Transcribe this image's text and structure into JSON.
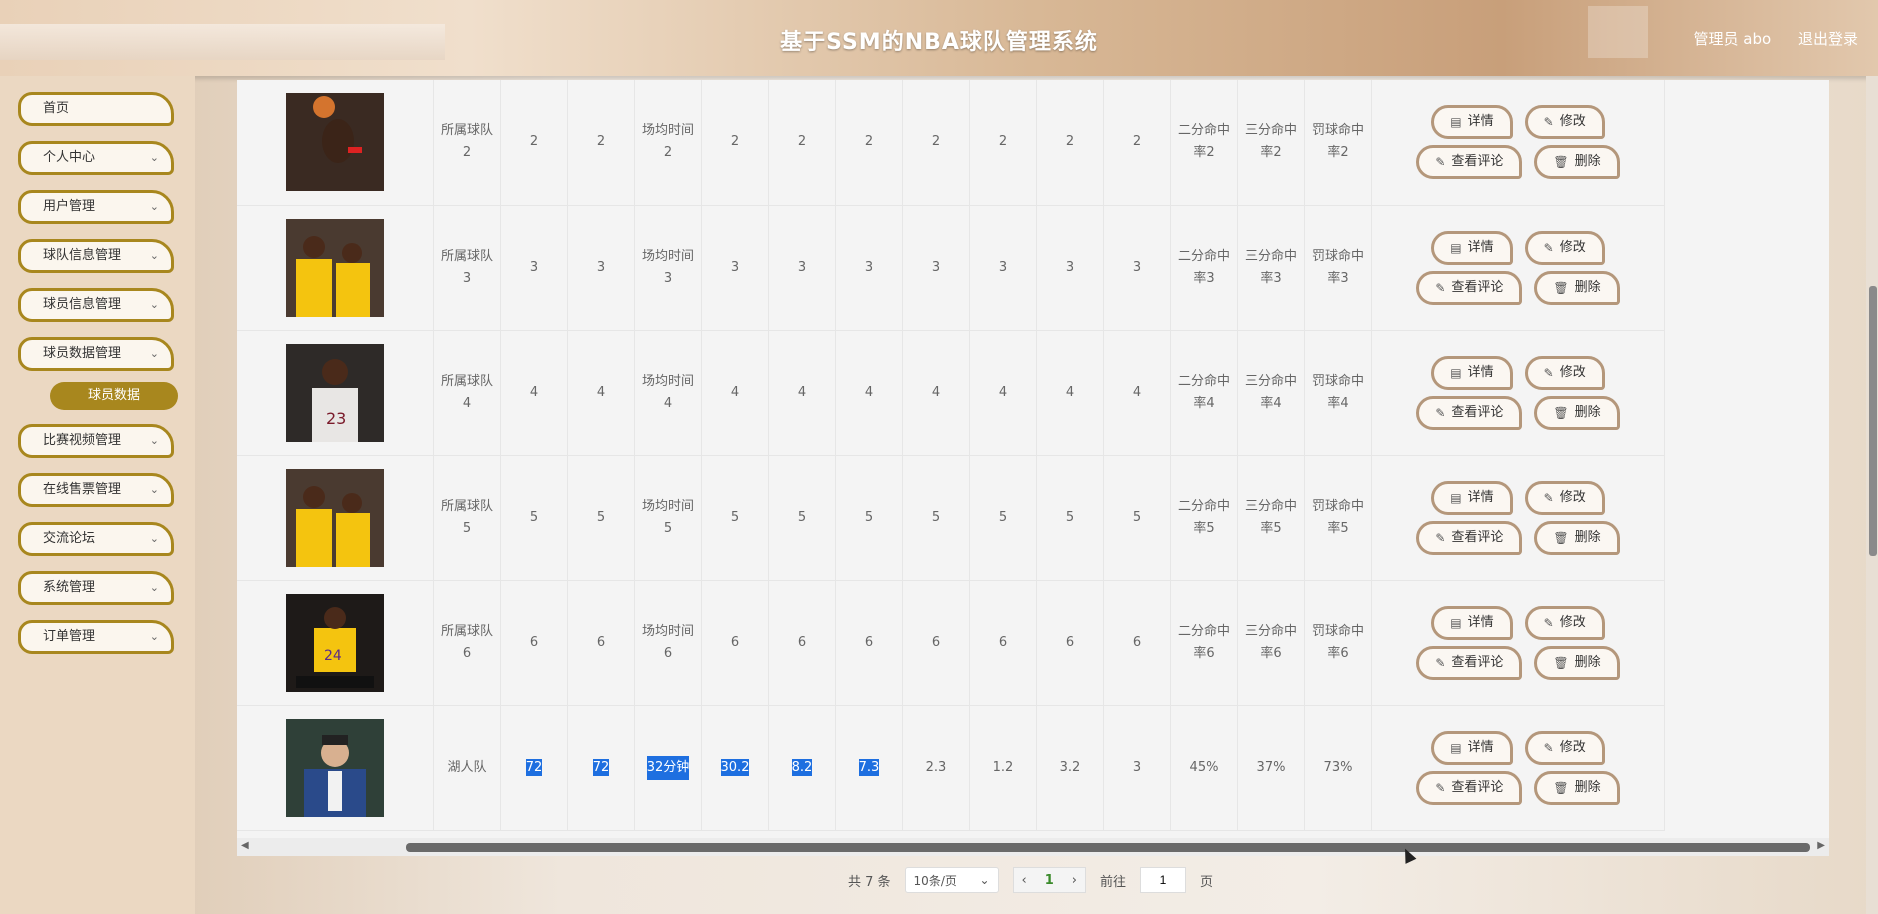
{
  "header": {
    "title": "基于SSM的NBA球队管理系统",
    "user_label": "管理员 abo",
    "logout_label": "退出登录"
  },
  "sidebar": {
    "items": [
      {
        "label": "首页",
        "has_chevron": false
      },
      {
        "label": "个人中心",
        "has_chevron": true
      },
      {
        "label": "用户管理",
        "has_chevron": true
      },
      {
        "label": "球队信息管理",
        "has_chevron": true
      },
      {
        "label": "球员信息管理",
        "has_chevron": true
      },
      {
        "label": "球员数据管理",
        "has_chevron": true
      },
      {
        "label": "比赛视频管理",
        "has_chevron": true
      },
      {
        "label": "在线售票管理",
        "has_chevron": true
      },
      {
        "label": "交流论坛",
        "has_chevron": true
      },
      {
        "label": "系统管理",
        "has_chevron": true
      },
      {
        "label": "订单管理",
        "has_chevron": true
      }
    ],
    "active_sub": "球员数据"
  },
  "table": {
    "rows": [
      {
        "photo": "basketball-player-shooting",
        "team": "所属球队2",
        "c1": "2",
        "c2": "2",
        "time": "场均时间2",
        "c4": "2",
        "c5": "2",
        "c6": "2",
        "c7": "2",
        "c8": "2",
        "c9": "2",
        "c10": "2",
        "two": "二分命中率2",
        "three": "三分命中率2",
        "ft": "罚球命中率2"
      },
      {
        "photo": "two-lakers-players",
        "team": "所属球队3",
        "c1": "3",
        "c2": "3",
        "time": "场均时间3",
        "c4": "3",
        "c5": "3",
        "c6": "3",
        "c7": "3",
        "c8": "3",
        "c9": "3",
        "c10": "3",
        "two": "二分命中率3",
        "three": "三分命中率3",
        "ft": "罚球命中率3"
      },
      {
        "photo": "cavaliers-player-23",
        "team": "所属球队4",
        "c1": "4",
        "c2": "4",
        "time": "场均时间4",
        "c4": "4",
        "c5": "4",
        "c6": "4",
        "c7": "4",
        "c8": "4",
        "c9": "4",
        "c10": "4",
        "two": "二分命中率4",
        "three": "三分命中率4",
        "ft": "罚球命中率4"
      },
      {
        "photo": "two-lakers-players",
        "team": "所属球队5",
        "c1": "5",
        "c2": "5",
        "time": "场均时间5",
        "c4": "5",
        "c5": "5",
        "c6": "5",
        "c7": "5",
        "c8": "5",
        "c9": "5",
        "c10": "5",
        "two": "二分命中率5",
        "three": "三分命中率5",
        "ft": "罚球命中率5"
      },
      {
        "photo": "kobe-bryant-24",
        "team": "所属球队6",
        "c1": "6",
        "c2": "6",
        "time": "场均时间6",
        "c4": "6",
        "c5": "6",
        "c6": "6",
        "c7": "6",
        "c8": "6",
        "c9": "6",
        "c10": "6",
        "two": "二分命中率6",
        "three": "三分命中率6",
        "ft": "罚球命中率6"
      },
      {
        "photo": "man-in-blue-suit",
        "team": "湖人队",
        "c1": "72",
        "c2": "72",
        "time": "32分钟",
        "c4": "30.2",
        "c5": "8.2",
        "c6": "7.3",
        "c7": "2.3",
        "c8": "1.2",
        "c9": "3.2",
        "c10": "3",
        "two": "45%",
        "three": "37%",
        "ft": "73%"
      }
    ],
    "actions": {
      "detail": "详情",
      "edit": "修改",
      "comments": "查看评论",
      "delete": "删除"
    }
  },
  "pagination": {
    "total": "共 7 条",
    "page_size": "10条/页",
    "current_page": "1",
    "goto_label": "前往",
    "goto_value": "1",
    "page_suffix": "页"
  }
}
